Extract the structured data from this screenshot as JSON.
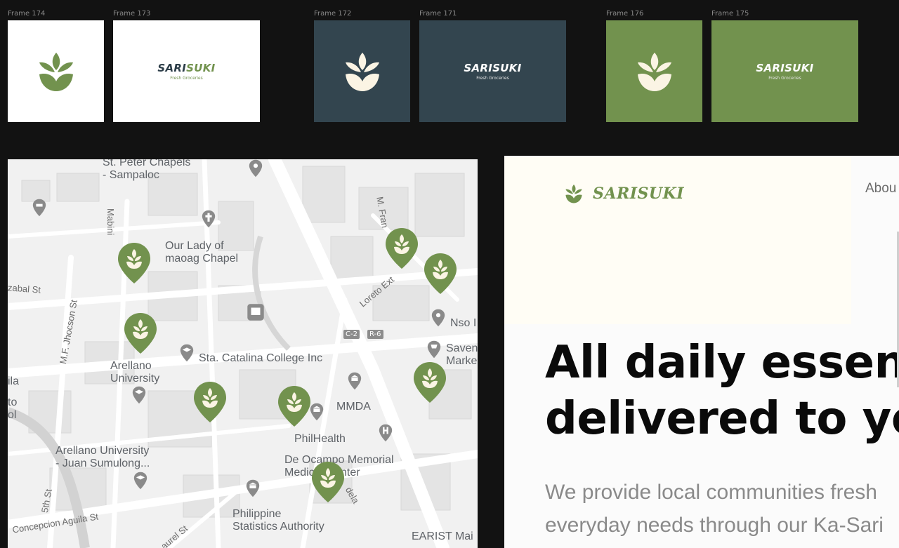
{
  "frames": [
    {
      "label": "Frame 174"
    },
    {
      "label": "Frame 173",
      "brand_a": "SARI",
      "brand_b": "SUKI",
      "tagline": "Fresh Groceries"
    },
    {
      "label": "Frame 172"
    },
    {
      "label": "Frame 171",
      "brand_a": "SARI",
      "brand_b": "SUKI",
      "tagline": "Fresh Groceries"
    },
    {
      "label": "Frame 176"
    },
    {
      "label": "Frame 175",
      "brand_a": "SARI",
      "brand_b": "SUKI",
      "tagline": "Fresh Groceries"
    }
  ],
  "colors": {
    "brand_green": "#72924e",
    "brand_slate": "#33454f",
    "cream": "#fffdf5"
  },
  "map": {
    "labels": {
      "st_peter": "St. Peter Chapels\n- Sampaloc",
      "mabini": "Mabini",
      "our_lady": "Our Lady of\nmaoag Chapel",
      "zabal": "zabal St",
      "m_fran": "M. Fran",
      "loreto": "Loreto Ext",
      "nso": "Nso I",
      "jhocson": "M.F. Jhocson St",
      "sta_catalina": "Sta. Catalina College Inc",
      "saven": "Saven\nMarke",
      "arellano": "Arellano\nUniversity",
      "ila": "ila",
      "to_ol": "to\nol",
      "mmda": "MMDA",
      "philhealth": "PhilHealth",
      "arellano_juan": "Arellano University\n- Juan Sumulong...",
      "de_ocampo": "De Ocampo Memorial\nMedical Center",
      "fifth": "5th St",
      "concepcion": "Concepcion Aguila St",
      "laurel": "aurel St",
      "psa": "Philippine\nStatistics Authority",
      "earist": "EARIST Mai",
      "dela": "dela",
      "c2": "C-2",
      "r6": "R-6"
    },
    "pin_icon": "sarisuki-leaf-pin-icon"
  },
  "landing": {
    "brand": "SARISUKI",
    "nav_about": "Abou",
    "headline_1": "All daily essen",
    "headline_2": "delivered to yo",
    "para_1": "We provide local communities fresh",
    "para_2": "everyday needs through our Ka-Sari"
  }
}
